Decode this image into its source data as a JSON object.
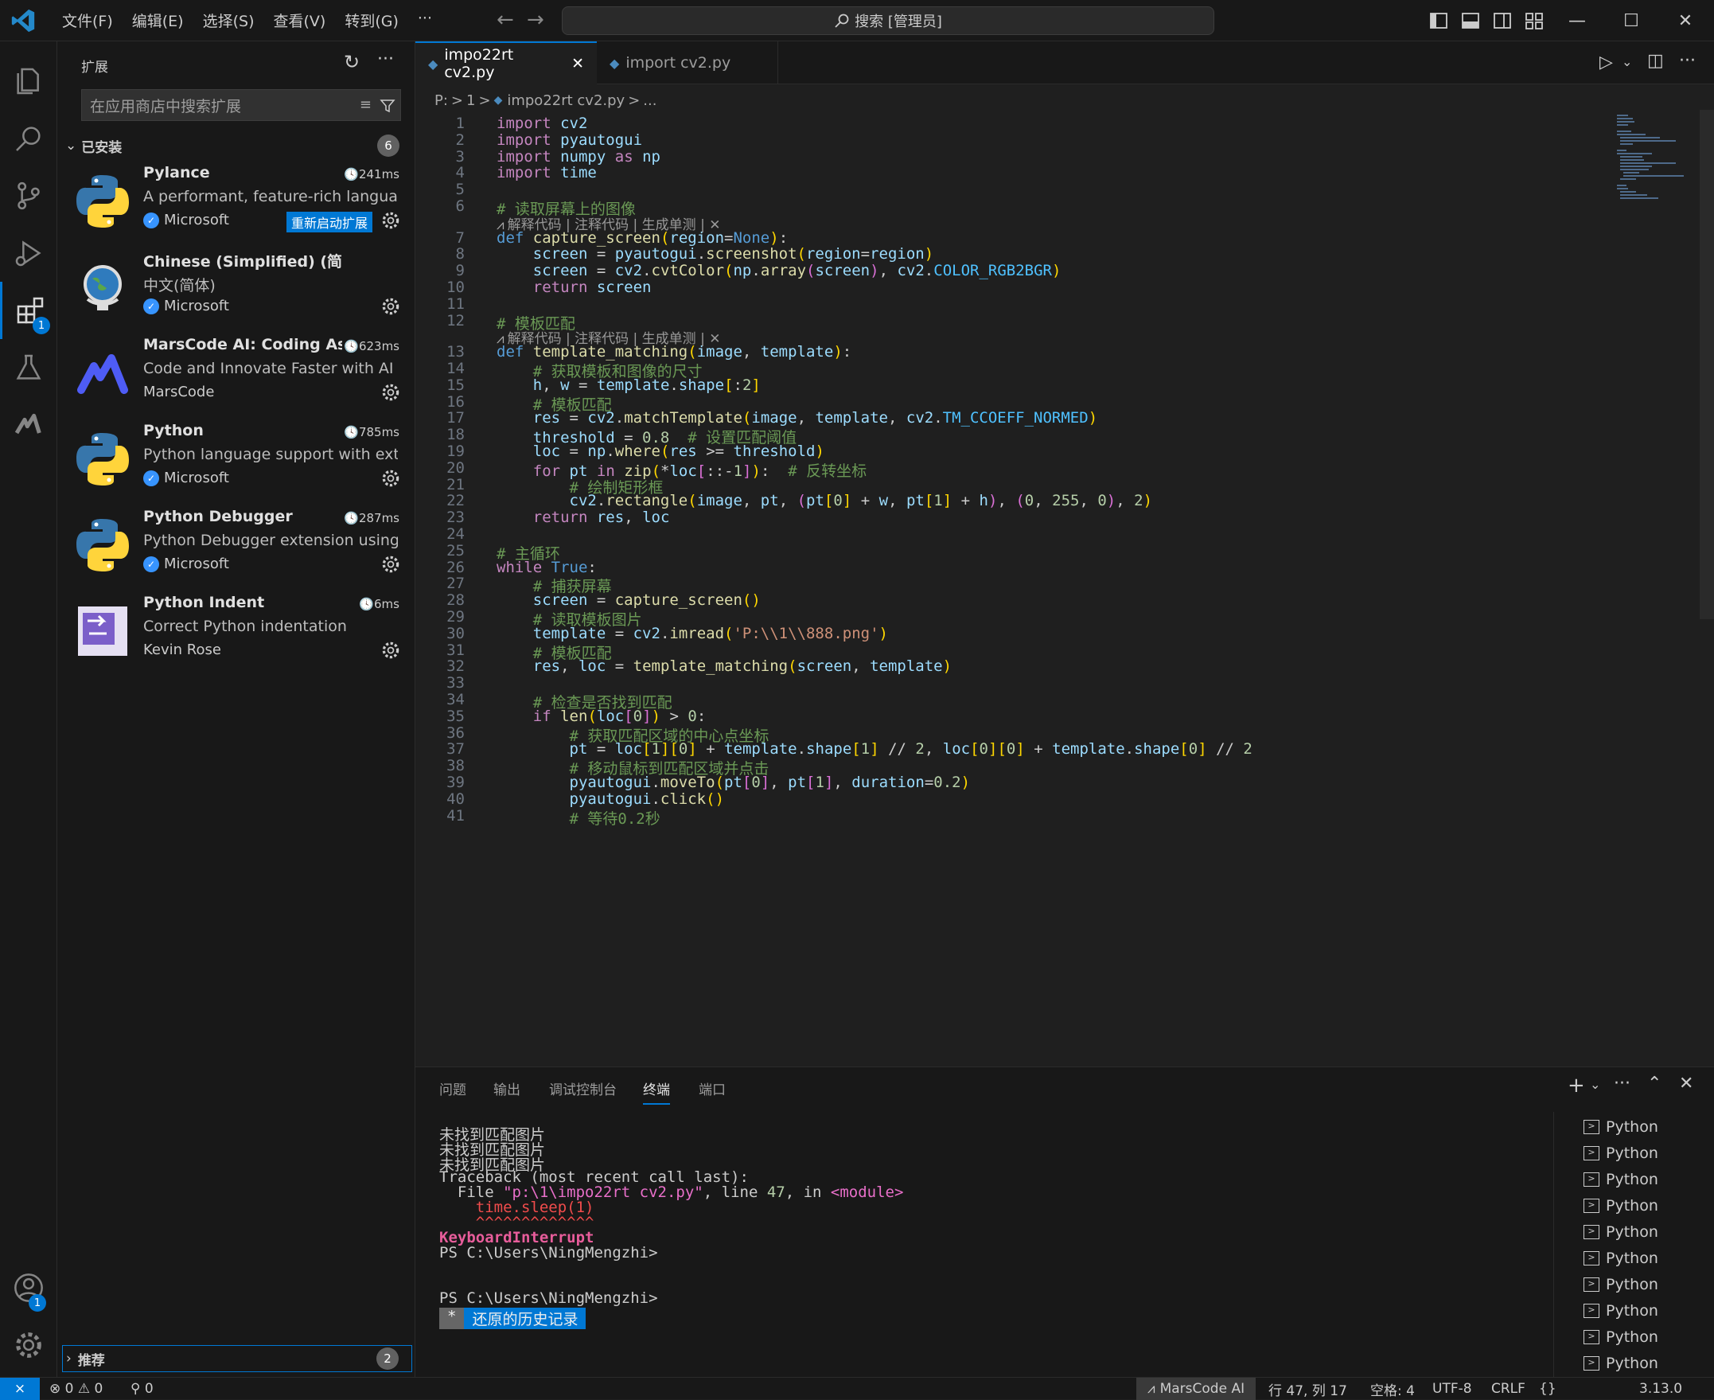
{
  "menu": [
    "文件(F)",
    "编辑(E)",
    "选择(S)",
    "查看(V)",
    "转到(G)",
    "···"
  ],
  "search": {
    "label": "搜索 [管理员]"
  },
  "sidebar": {
    "title": "扩展",
    "search_placeholder": "在应用商店中搜索扩展",
    "installed_label": "已安装",
    "installed_count": "6",
    "recommended_label": "推荐",
    "recommended_count": "2",
    "extensions": [
      {
        "name": "Pylance",
        "time": "241ms",
        "desc": "A performant, feature-rich languag...",
        "publisher": "Microsoft",
        "verified": true,
        "action": "重新启动扩展",
        "icon": "python-logo-icon"
      },
      {
        "name": "Chinese (Simplified) (简体中文) L...",
        "time": "",
        "desc": "中文(简体)",
        "publisher": "Microsoft",
        "verified": true,
        "action": "",
        "icon": "globe-icon"
      },
      {
        "name": "MarsCode AI: Coding Ass...",
        "time": "623ms",
        "desc": "Code and Innovate Faster with AI",
        "publisher": "MarsCode",
        "verified": false,
        "action": "",
        "icon": "marscode-icon"
      },
      {
        "name": "Python",
        "time": "785ms",
        "desc": "Python language support with exte...",
        "publisher": "Microsoft",
        "verified": true,
        "action": "",
        "icon": "python-logo-icon"
      },
      {
        "name": "Python Debugger",
        "time": "287ms",
        "desc": "Python Debugger extension using d...",
        "publisher": "Microsoft",
        "verified": true,
        "action": "",
        "icon": "python-logo-icon"
      },
      {
        "name": "Python Indent",
        "time": "6ms",
        "desc": "Correct Python indentation",
        "publisher": "Kevin Rose",
        "verified": false,
        "action": "",
        "icon": "python-indent-icon"
      }
    ]
  },
  "activity": {
    "extensions_badge": "1",
    "accounts_badge": "1"
  },
  "editor": {
    "tabs": [
      {
        "label": "impo22rt cv2.py",
        "active": true
      },
      {
        "label": "import cv2.py",
        "active": false
      }
    ],
    "breadcrumb": [
      "P:",
      ">",
      "1",
      ">",
      "impo22rt cv2.py",
      ">",
      "..."
    ],
    "codelens": "解释代码 | 注释代码 | 生成单测 | ✕",
    "lines": [
      {
        "n": "1",
        "t": "import cv2"
      },
      {
        "n": "2",
        "t": "import pyautogui"
      },
      {
        "n": "3",
        "t": "import numpy as np"
      },
      {
        "n": "4",
        "t": "import time"
      },
      {
        "n": "5",
        "t": ""
      },
      {
        "n": "6",
        "t": "# 读取屏幕上的图像"
      },
      {
        "n": "7",
        "t": "def capture_screen(region=None):"
      },
      {
        "n": "8",
        "t": "    screen = pyautogui.screenshot(region=region)"
      },
      {
        "n": "9",
        "t": "    screen = cv2.cvtColor(np.array(screen), cv2.COLOR_RGB2BGR)"
      },
      {
        "n": "10",
        "t": "    return screen"
      },
      {
        "n": "11",
        "t": ""
      },
      {
        "n": "12",
        "t": "# 模板匹配"
      },
      {
        "n": "13",
        "t": "def template_matching(image, template):"
      },
      {
        "n": "14",
        "t": "    # 获取模板和图像的尺寸"
      },
      {
        "n": "15",
        "t": "    h, w = template.shape[:2]"
      },
      {
        "n": "16",
        "t": "    # 模板匹配"
      },
      {
        "n": "17",
        "t": "    res = cv2.matchTemplate(image, template, cv2.TM_CCOEFF_NORMED)"
      },
      {
        "n": "18",
        "t": "    threshold = 0.8  # 设置匹配阈值"
      },
      {
        "n": "19",
        "t": "    loc = np.where(res >= threshold)"
      },
      {
        "n": "20",
        "t": "    for pt in zip(*loc[::-1]):  # 反转坐标"
      },
      {
        "n": "21",
        "t": "        # 绘制矩形框"
      },
      {
        "n": "22",
        "t": "        cv2.rectangle(image, pt, (pt[0] + w, pt[1] + h), (0, 255, 0), 2)"
      },
      {
        "n": "23",
        "t": "    return res, loc"
      },
      {
        "n": "24",
        "t": ""
      },
      {
        "n": "25",
        "t": "# 主循环"
      },
      {
        "n": "26",
        "t": "while True:"
      },
      {
        "n": "27",
        "t": "    # 捕获屏幕"
      },
      {
        "n": "28",
        "t": "    screen = capture_screen()"
      },
      {
        "n": "29",
        "t": "    # 读取模板图片"
      },
      {
        "n": "30",
        "t": "    template = cv2.imread('P:\\\\1\\\\888.png')"
      },
      {
        "n": "31",
        "t": "    # 模板匹配"
      },
      {
        "n": "32",
        "t": "    res, loc = template_matching(screen, template)"
      },
      {
        "n": "33",
        "t": ""
      },
      {
        "n": "34",
        "t": "    # 检查是否找到匹配"
      },
      {
        "n": "35",
        "t": "    if len(loc[0]) > 0:"
      },
      {
        "n": "36",
        "t": "        # 获取匹配区域的中心点坐标"
      },
      {
        "n": "37",
        "t": "        pt = loc[1][0] + template.shape[1] // 2, loc[0][0] + template.shape[0] // 2"
      },
      {
        "n": "38",
        "t": "        # 移动鼠标到匹配区域并点击"
      },
      {
        "n": "39",
        "t": "        pyautogui.moveTo(pt[0], pt[1], duration=0.2)"
      },
      {
        "n": "40",
        "t": "        pyautogui.click()"
      },
      {
        "n": "41",
        "t": "        # 等待0.2秒"
      }
    ]
  },
  "panel": {
    "tabs": [
      "问题",
      "输出",
      "调试控制台",
      "终端",
      "端口"
    ],
    "active_tab": "终端",
    "terminal": [
      "未找到匹配图片",
      "未找到匹配图片",
      "未找到匹配图片",
      "Traceback (most recent call last):",
      "  File \"p:\\1\\impo22rt cv2.py\", line 47, in <module>",
      "    time.sleep(1)",
      "    ^^^^^^^^^^^^^",
      "KeyboardInterrupt",
      "PS C:\\Users\\NingMengzhi>",
      "",
      "",
      "PS C:\\Users\\NingMengzhi>"
    ],
    "history_star": "*",
    "history_label": "还原的历史记录",
    "terminals": [
      "Python",
      "Python",
      "Python",
      "Python",
      "Python",
      "Python",
      "Python",
      "Python",
      "Python",
      "Python"
    ]
  },
  "status": {
    "errors": "0",
    "warnings": "0",
    "ports": "0",
    "marscode": "MarsCode AI",
    "position": "行 47, 列 17",
    "spaces": "空格: 4",
    "encoding": "UTF-8",
    "eol": "CRLF",
    "braces": "{}",
    "version": "3.13.0"
  },
  "colors": {
    "accent": "#0078d4",
    "background": "#1f1f1f",
    "sidebar": "#181818"
  }
}
